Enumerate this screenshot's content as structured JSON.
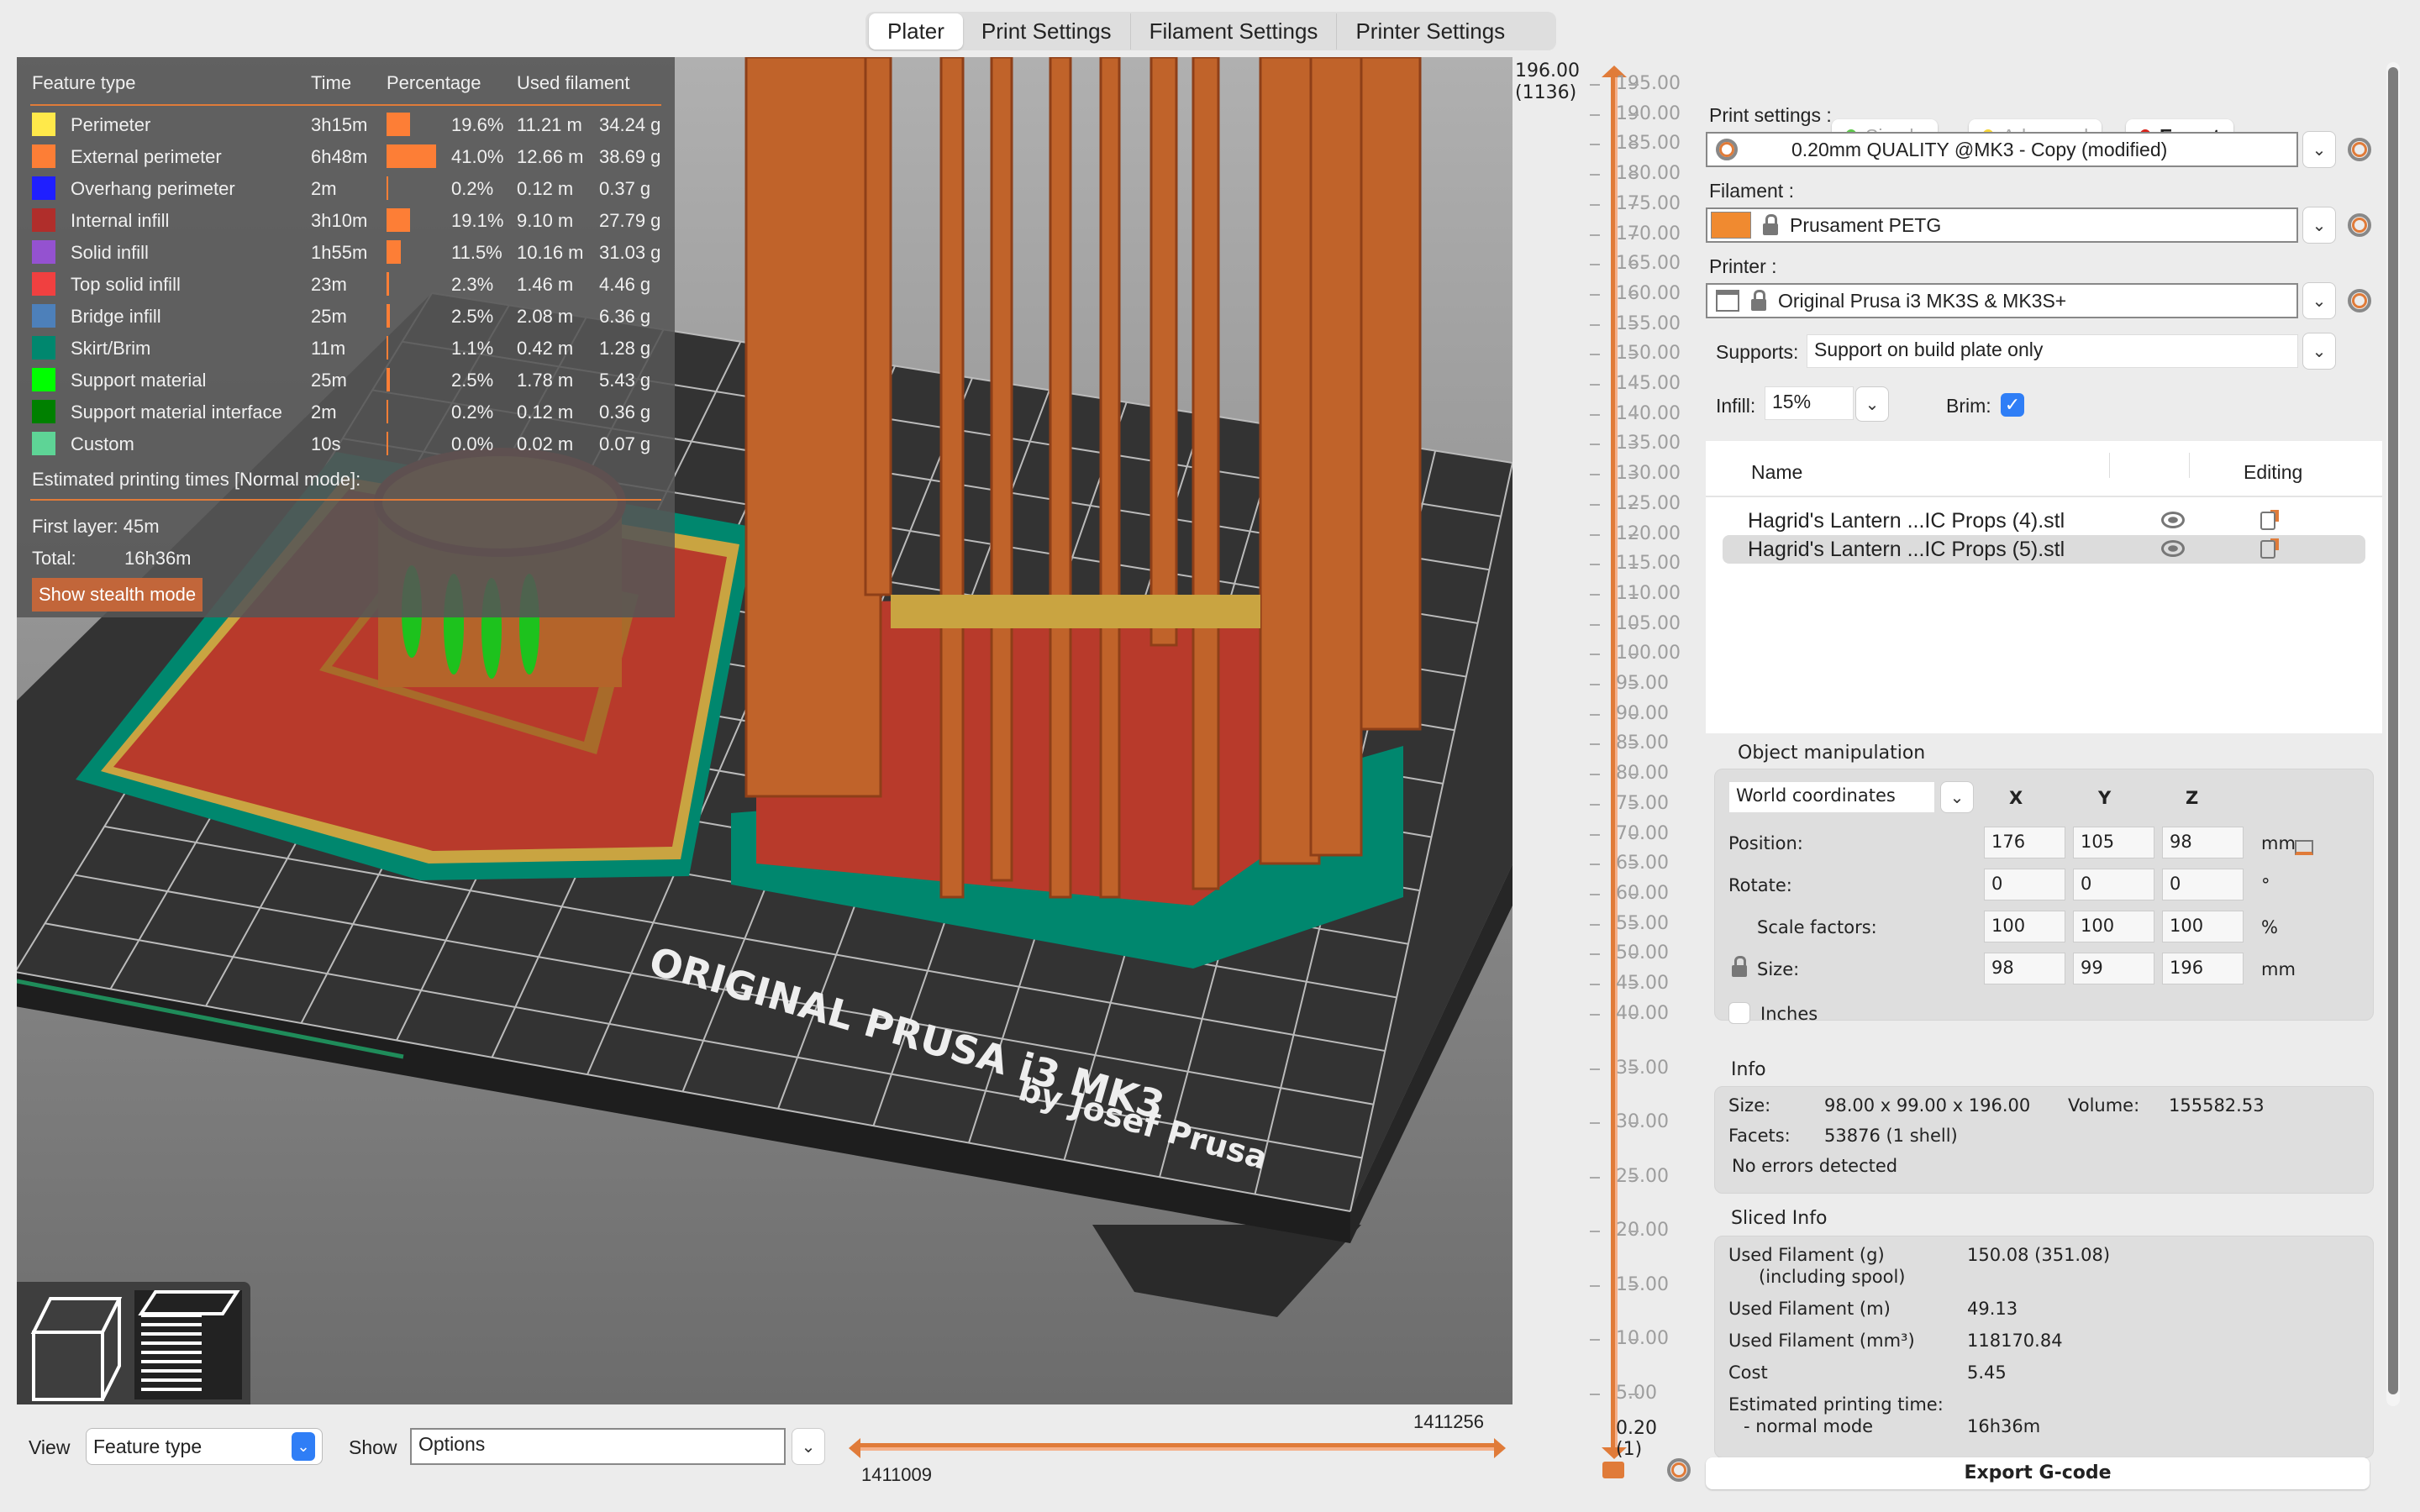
{
  "tabs": [
    "Plater",
    "Print Settings",
    "Filament Settings",
    "Printer Settings"
  ],
  "legend": {
    "headers": {
      "feature": "Feature type",
      "time": "Time",
      "percentage": "Percentage",
      "used": "Used filament"
    },
    "rows": [
      {
        "name": "Perimeter",
        "color": "#ffe94a",
        "time": "3h15m",
        "pct": 19.6,
        "pct_label": "19.6%",
        "m": "11.21 m",
        "g": "34.24 g"
      },
      {
        "name": "External perimeter",
        "color": "#fd7e36",
        "time": "6h48m",
        "pct": 41.0,
        "pct_label": "41.0%",
        "m": "12.66 m",
        "g": "38.69 g"
      },
      {
        "name": "Overhang perimeter",
        "color": "#1f1fff",
        "time": "2m",
        "pct": 0.2,
        "pct_label": "0.2%",
        "m": "0.12 m",
        "g": "0.37 g"
      },
      {
        "name": "Internal infill",
        "color": "#b02e2b",
        "time": "3h10m",
        "pct": 19.1,
        "pct_label": "19.1%",
        "m": "9.10 m",
        "g": "27.79 g"
      },
      {
        "name": "Solid infill",
        "color": "#9452d0",
        "time": "1h55m",
        "pct": 11.5,
        "pct_label": "11.5%",
        "m": "10.16 m",
        "g": "31.03 g"
      },
      {
        "name": "Top solid infill",
        "color": "#f04040",
        "time": "23m",
        "pct": 2.3,
        "pct_label": "2.3%",
        "m": "1.46 m",
        "g": "4.46 g"
      },
      {
        "name": "Bridge infill",
        "color": "#4d80ba",
        "time": "25m",
        "pct": 2.5,
        "pct_label": "2.5%",
        "m": "2.08 m",
        "g": "6.36 g"
      },
      {
        "name": "Skirt/Brim",
        "color": "#00876e",
        "time": "11m",
        "pct": 1.1,
        "pct_label": "1.1%",
        "m": "0.42 m",
        "g": "1.28 g"
      },
      {
        "name": "Support material",
        "color": "#00ff00",
        "time": "25m",
        "pct": 2.5,
        "pct_label": "2.5%",
        "m": "1.78 m",
        "g": "5.43 g"
      },
      {
        "name": "Support material interface",
        "color": "#008000",
        "time": "2m",
        "pct": 0.2,
        "pct_label": "0.2%",
        "m": "0.12 m",
        "g": "0.36 g"
      },
      {
        "name": "Custom",
        "color": "#5ed496",
        "time": "10s",
        "pct": 0.0,
        "pct_label": "0.0%",
        "m": "0.02 m",
        "g": "0.07 g"
      }
    ],
    "estimated_title": "Estimated printing times [Normal mode]:",
    "first_layer": "First layer: 45m",
    "total_label": "Total:",
    "total_value": "16h36m",
    "stealth_button": "Show stealth mode"
  },
  "bed_text": {
    "line1": "ORIGINAL PRUSA i3 MK3",
    "line2": "by Josef Prusa"
  },
  "bottom": {
    "view_label": "View",
    "view_value": "Feature type",
    "show_label": "Show",
    "show_value": "Options",
    "hslider_max": "1411256",
    "hslider_min": "1411009"
  },
  "vslider": {
    "top_value": "196.00",
    "top_layer": "(1136)",
    "bottom_value": "0.20",
    "bottom_layer": "(1)",
    "ticks": [
      "195.00",
      "190.00",
      "185.00",
      "180.00",
      "175.00",
      "170.00",
      "165.00",
      "160.00",
      "155.00",
      "150.00",
      "145.00",
      "140.00",
      "135.00",
      "130.00",
      "125.00",
      "120.00",
      "115.00",
      "110.00",
      "105.00",
      "100.00",
      "95.00",
      "90.00",
      "85.00",
      "80.00",
      "75.00",
      "70.00",
      "65.00",
      "60.00",
      "55.00",
      "50.00",
      "45.00",
      "40.00",
      "35.00",
      "30.00",
      "25.00",
      "20.00",
      "15.00",
      "10.00",
      "5.00"
    ]
  },
  "modes": {
    "simple": "Simple",
    "advanced": "Advanced",
    "expert": "Expert",
    "simple_color": "#5ec94a",
    "advanced_color": "#f7d536",
    "expert_color": "#d8231a"
  },
  "print_settings": {
    "label": "Print settings :",
    "value": "0.20mm QUALITY @MK3 - Copy (modified)"
  },
  "filament": {
    "label": "Filament :",
    "value": "Prusament PETG",
    "color": "#f08a30"
  },
  "printer": {
    "label": "Printer :",
    "value": "Original Prusa i3 MK3S & MK3S+"
  },
  "supports": {
    "label": "Supports:",
    "value": "Support on build plate only"
  },
  "infill": {
    "label": "Infill:",
    "value": "15%"
  },
  "brim": {
    "label": "Brim:",
    "checked": true
  },
  "objects": {
    "col_name": "Name",
    "col_editing": "Editing",
    "items": [
      "Hagrid's Lantern ...IC Props (4).stl",
      "Hagrid's Lantern ...IC Props (5).stl"
    ]
  },
  "manip": {
    "title": "Object manipulation",
    "coords": "World coordinates",
    "x": "X",
    "y": "Y",
    "z": "Z",
    "position_label": "Position:",
    "position": [
      "176",
      "105",
      "98"
    ],
    "position_unit": "mm",
    "rotate_label": "Rotate:",
    "rotate": [
      "0",
      "0",
      "0"
    ],
    "rotate_unit": "°",
    "scale_label": "Scale factors:",
    "scale": [
      "100",
      "100",
      "100"
    ],
    "scale_unit": "%",
    "size_label": "Size:",
    "size": [
      "98",
      "99",
      "196"
    ],
    "size_unit": "mm",
    "inches_label": "Inches"
  },
  "info": {
    "title": "Info",
    "size_label": "Size:",
    "size": "98.00 x 99.00 x 196.00",
    "volume_label": "Volume:",
    "volume": "155582.53",
    "facets_label": "Facets:",
    "facets": "53876 (1 shell)",
    "errors": "No errors detected"
  },
  "sliced": {
    "title": "Sliced Info",
    "rows": [
      {
        "label": "Used Filament (g)",
        "sub": "(including spool)",
        "value": "150.08 (351.08)"
      },
      {
        "label": "Used Filament (m)",
        "value": "49.13"
      },
      {
        "label": "Used Filament (mm³)",
        "value": "118170.84"
      },
      {
        "label": "Cost",
        "value": "5.45"
      },
      {
        "label": "Estimated printing time:",
        "value": ""
      },
      {
        "label": "- normal mode",
        "value": "16h36m"
      }
    ]
  },
  "export_button": "Export G-code"
}
